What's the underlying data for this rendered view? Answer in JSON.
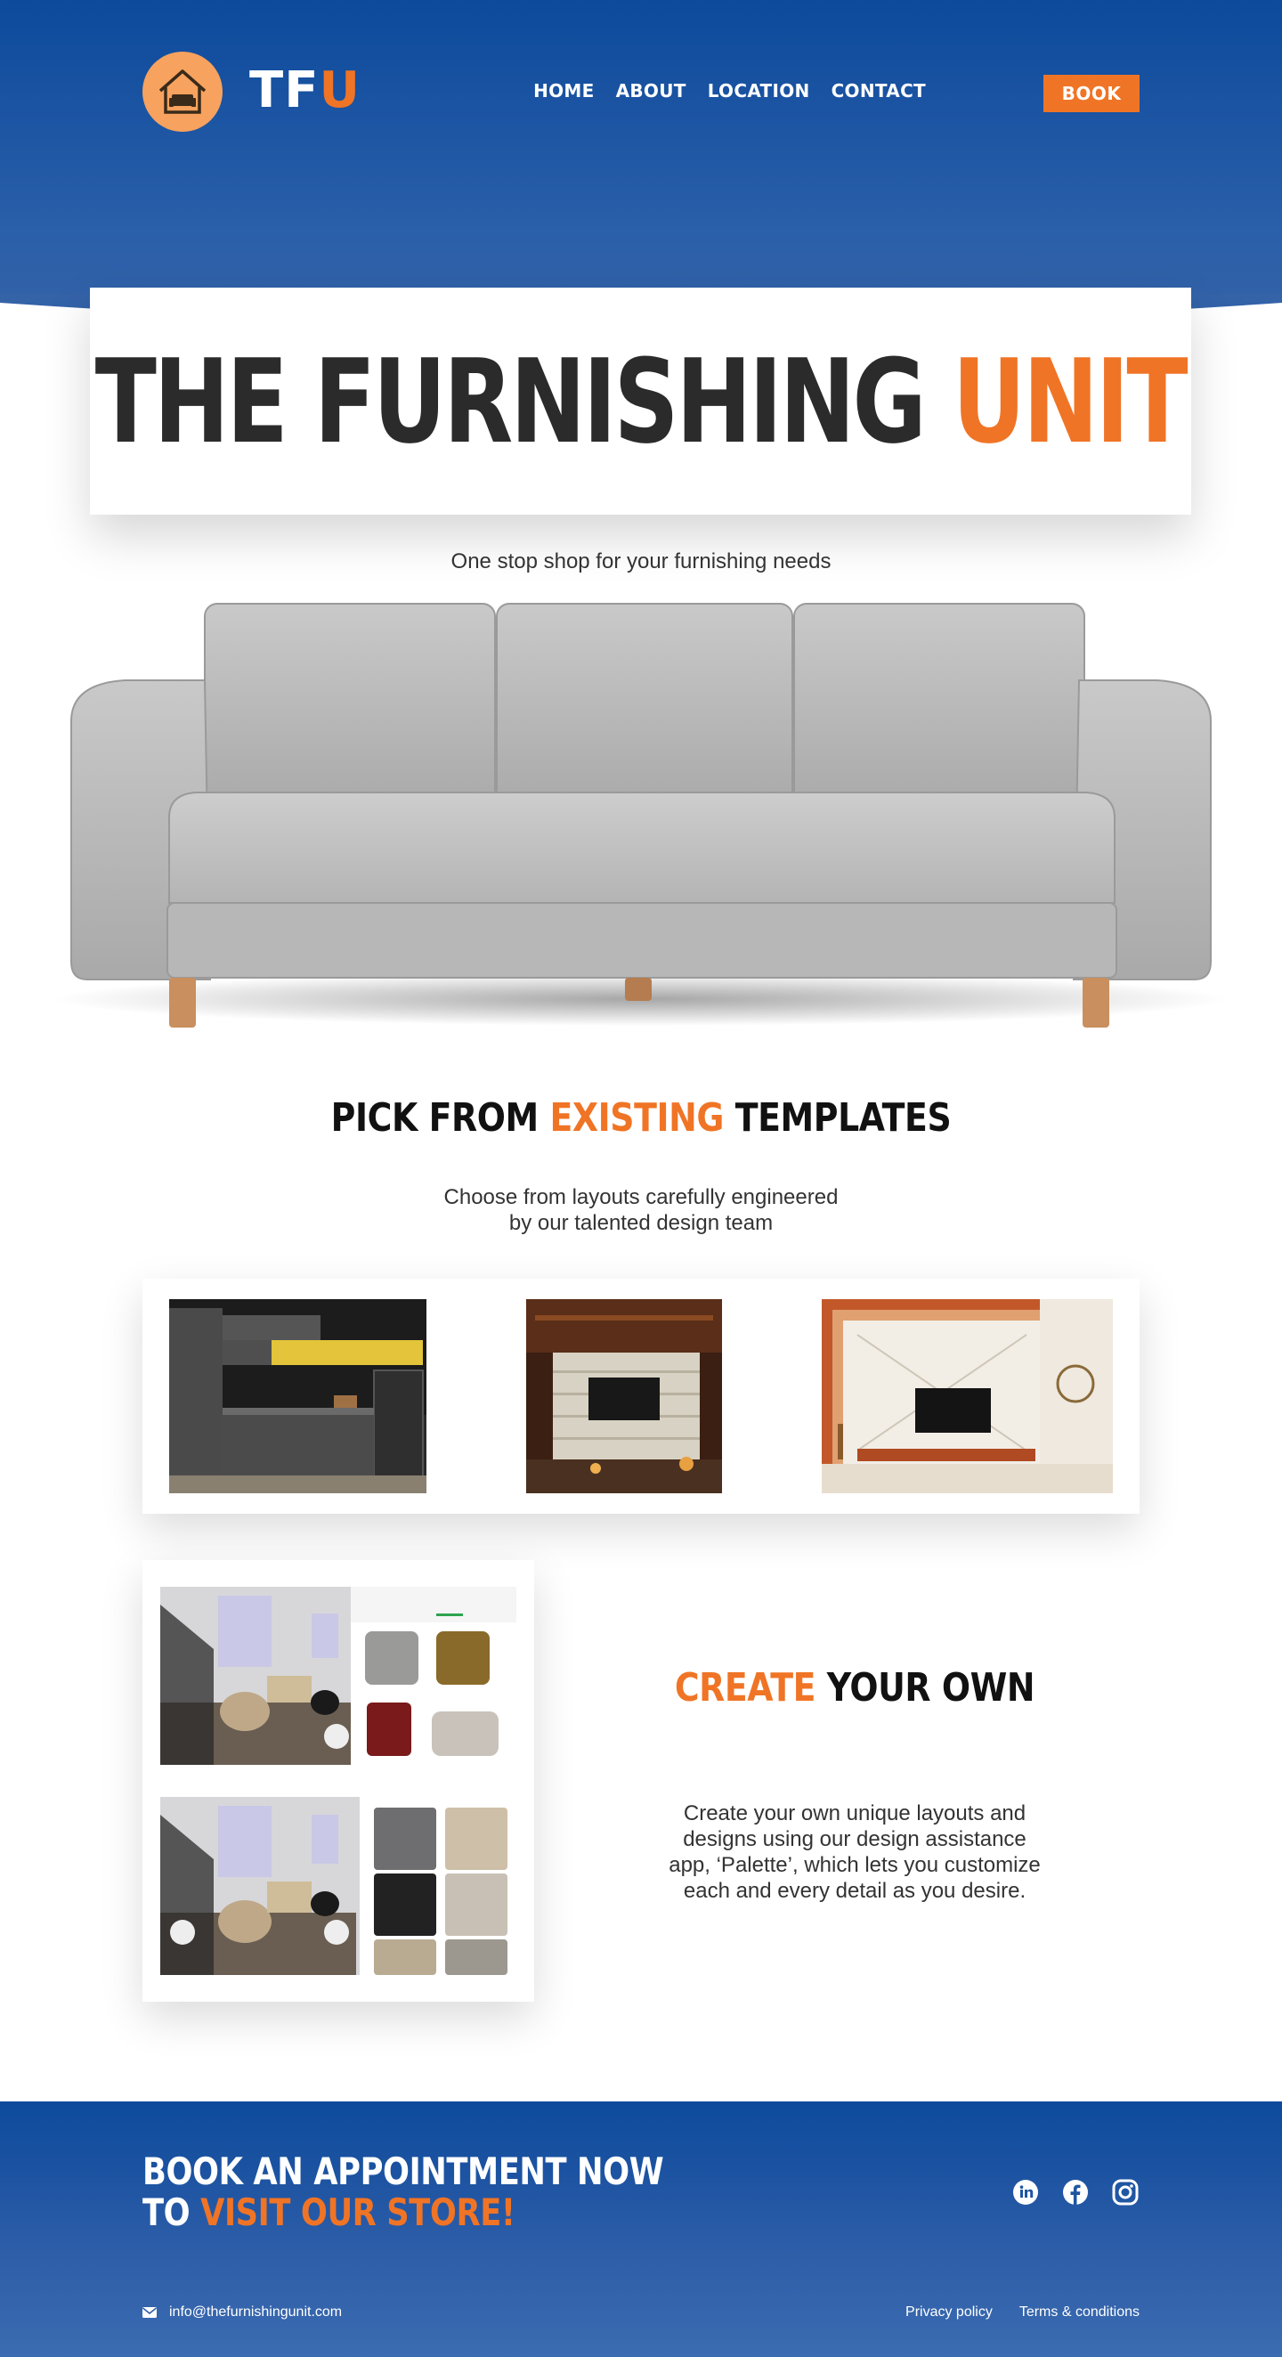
{
  "header": {
    "logo": {
      "text_main": "TF",
      "text_accent": "U",
      "icon": "house-sofa-icon"
    },
    "nav": [
      {
        "label": "HOME"
      },
      {
        "label": "ABOUT"
      },
      {
        "label": "LOCATION"
      },
      {
        "label": "CONTACT"
      }
    ],
    "book_label": "BOOK"
  },
  "hero": {
    "title_main": "THE FURNISHING ",
    "title_accent": "UNIT",
    "tagline": "One stop shop for your furnishing needs",
    "image": "grey-three-seat-sofa"
  },
  "templates_section": {
    "heading_pre": "PICK FROM ",
    "heading_accent": "EXISTING",
    "heading_post": " TEMPLATES",
    "subtitle_line1": "Choose from layouts carefully engineered",
    "subtitle_line2": "by our talented design team",
    "images": [
      "modern-kitchen",
      "wood-tv-wall",
      "living-room-tv-unit"
    ]
  },
  "create_section": {
    "heading_accent": "CREATE",
    "heading_post": " YOUR OWN",
    "body_lines": [
      "Create your own unique layouts and",
      "designs using our design assistance",
      "app, ‘Palette’, which lets you customize",
      "each and every detail as you desire."
    ],
    "images": [
      "palette-app-furniture-picker",
      "palette-app-fabric-picker"
    ]
  },
  "footer": {
    "cta_line1": "BOOK AN APPOINTMENT NOW",
    "cta_line2_pre": "TO ",
    "cta_line2_accent": "VISIT OUR STORE!",
    "socials": [
      "linkedin-icon",
      "facebook-icon",
      "instagram-icon"
    ],
    "email": "info@thefurnishingunit.com",
    "legal": [
      {
        "label": "Privacy policy"
      },
      {
        "label": "Terms & conditions"
      }
    ]
  },
  "colors": {
    "brand_blue": "#0d4a9c",
    "accent_orange": "#f07425",
    "logo_orange": "#f7a25e",
    "text_dark": "#2b2b2b"
  }
}
